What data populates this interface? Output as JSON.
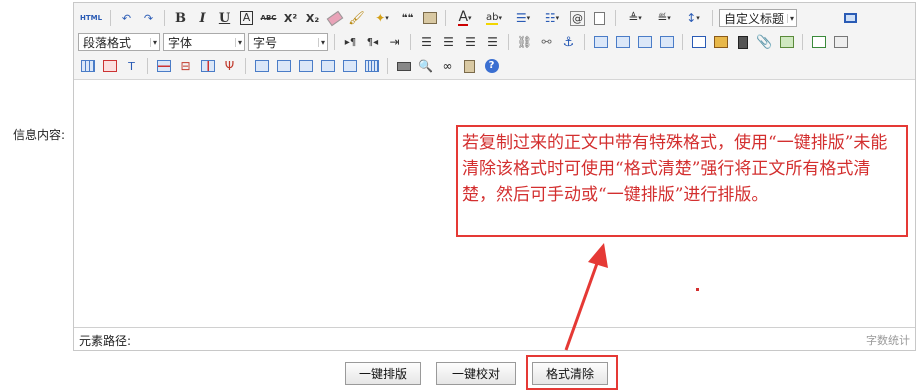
{
  "form": {
    "content_label": "信息内容:"
  },
  "toolbar": {
    "row1": {
      "html": "HTML",
      "bold": "B",
      "italic": "I",
      "underline": "U",
      "border": "A",
      "strike": "ABC",
      "superscript": "X²",
      "subscript": "X₂",
      "quote": "❝❝",
      "font_color": "A",
      "custom_title": "自定义标题"
    },
    "row2": {
      "paragraph": "段落格式",
      "font_family": "字体",
      "font_size": "字号"
    }
  },
  "editor": {
    "element_path": "元素路径:",
    "word_count": "字数统计",
    "note": "若复制过来的正文中带有特殊格式，使用“一键排版”未能清除该格式时可使用“格式清楚”强行将正文所有格式清楚，然后可手动或“一键排版”进行排版。"
  },
  "buttons": {
    "auto_layout": "一键排版",
    "proofread": "一键校对",
    "clear_format": "格式清除"
  },
  "colors": {
    "accent": "#e53935",
    "icon_blue": "#2a5bb5"
  }
}
